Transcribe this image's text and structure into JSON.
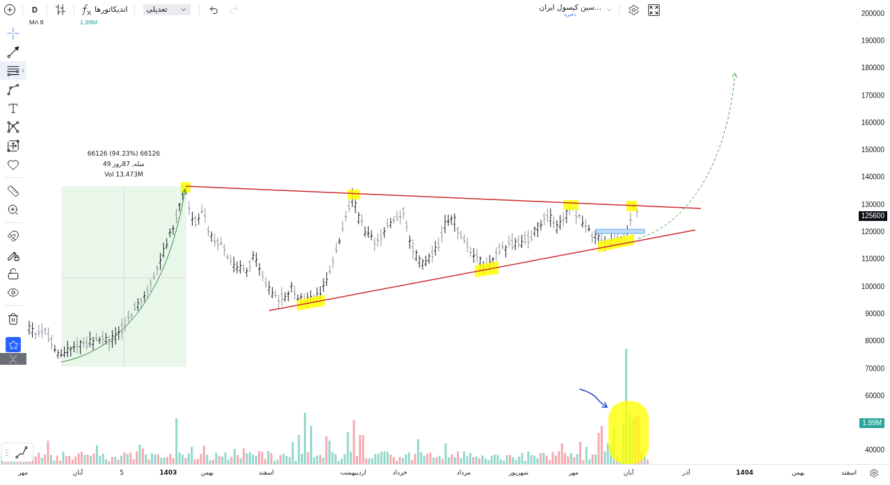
{
  "toolbar": {
    "interval": "D",
    "indicators_label": "اندیکاتورها",
    "adjustment_value": "تعدیلی",
    "history": [
      {
        "kind": "undo",
        "disabled": false
      },
      {
        "kind": "redo",
        "disabled": true
      }
    ]
  },
  "symbol": {
    "name": "...سین کپسول ایران",
    "status": "ذخیره"
  },
  "drawing_tools": [
    {
      "tools": [
        {
          "kind": "crosshair",
          "selected": true,
          "highlighted": false
        },
        {
          "kind": "trend_line",
          "selected": false,
          "highlighted": false
        },
        {
          "kind": "parallel_lines",
          "selected": false,
          "highlighted": true
        },
        {
          "kind": "path",
          "selected": false,
          "highlighted": false
        },
        {
          "kind": "text",
          "selected": false,
          "highlighted": false
        },
        {
          "kind": "pattern",
          "selected": false,
          "highlighted": false
        },
        {
          "kind": "projection",
          "selected": false,
          "highlighted": false
        },
        {
          "kind": "heart",
          "selected": false,
          "highlighted": false
        }
      ]
    },
    {
      "tools": [
        {
          "kind": "ruler",
          "selected": false,
          "highlighted": false
        },
        {
          "kind": "zoom",
          "selected": false,
          "highlighted": false
        }
      ]
    },
    {
      "tools": [
        {
          "kind": "magnet",
          "selected": false,
          "highlighted": false
        },
        {
          "kind": "drawing_lock",
          "selected": false,
          "highlighted": false
        },
        {
          "kind": "lock",
          "selected": false,
          "highlighted": false
        },
        {
          "kind": "eye",
          "selected": false,
          "highlighted": false
        }
      ]
    },
    {
      "tools": [
        {
          "kind": "trash",
          "selected": false,
          "highlighted": false
        }
      ]
    }
  ],
  "favorites": {
    "on": true
  },
  "chart": {
    "legend": {
      "label": "MA 9",
      "value": "1.99M"
    },
    "measurement": [
      "66126 (94.23%) 66126",
      "میله, 87روز 49",
      "Vol 13.473M"
    ],
    "last_price": "125600",
    "price_axis": [
      {
        "kind": "tick",
        "text": "200000"
      },
      {
        "kind": "tick",
        "text": "190000"
      },
      {
        "kind": "tick",
        "text": "180000"
      },
      {
        "kind": "tick",
        "text": "170000"
      },
      {
        "kind": "tick",
        "text": "160000"
      },
      {
        "kind": "tick",
        "text": "150000"
      },
      {
        "kind": "tick",
        "text": "140000"
      },
      {
        "kind": "tick",
        "text": "130000"
      },
      {
        "kind": "tick",
        "text": "120000"
      },
      {
        "kind": "tick",
        "text": "110000"
      },
      {
        "kind": "tick",
        "text": "100000"
      },
      {
        "kind": "tick",
        "text": "90000"
      },
      {
        "kind": "tick",
        "text": "80000"
      },
      {
        "kind": "tick",
        "text": "70000"
      },
      {
        "kind": "tick",
        "text": "60000"
      },
      {
        "kind": "volume",
        "text": "1.99M"
      },
      {
        "kind": "tick",
        "text": "40000"
      }
    ],
    "time_axis": [
      {
        "kind": "month",
        "text": "اسفند"
      },
      {
        "kind": "month",
        "text": "بهمن"
      },
      {
        "kind": "year",
        "text": "1404"
      },
      {
        "kind": "month",
        "text": "آذر"
      },
      {
        "kind": "month",
        "text": "آبان"
      },
      {
        "kind": "month",
        "text": "مهر"
      },
      {
        "kind": "month",
        "text": "شهریور"
      },
      {
        "kind": "month",
        "text": "مرداد"
      },
      {
        "kind": "month",
        "text": "خرداد"
      },
      {
        "kind": "month",
        "text": "اردیبهشت"
      },
      {
        "kind": "month",
        "text": "اسفند"
      },
      {
        "kind": "month",
        "text": "بهمن"
      },
      {
        "kind": "year",
        "text": "1403"
      },
      {
        "kind": "day",
        "text": "5"
      },
      {
        "kind": "month",
        "text": "آبان"
      },
      {
        "kind": "month",
        "text": "مهر"
      }
    ]
  }
}
